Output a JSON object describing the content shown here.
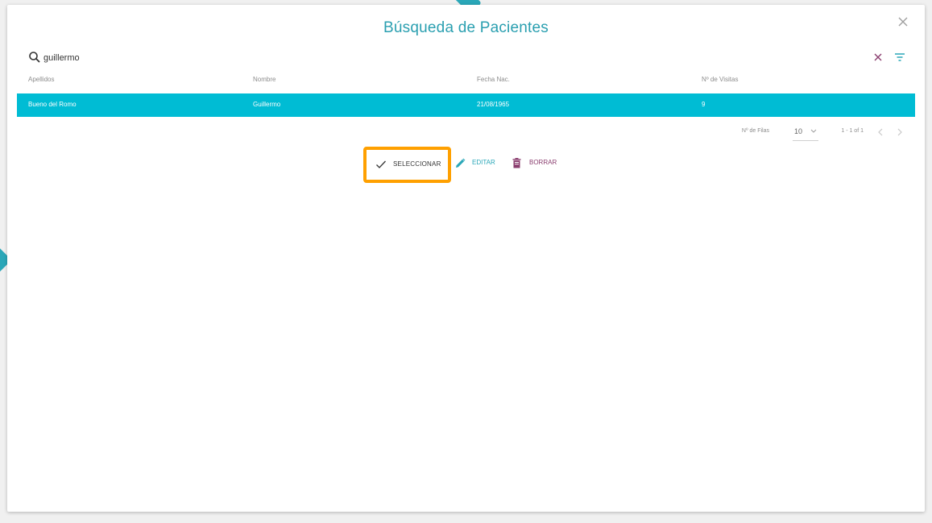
{
  "dialog": {
    "title": "Búsqueda de Pacientes",
    "close_icon": "close-icon"
  },
  "search": {
    "value": "guillermo",
    "placeholder": "",
    "search_icon": "search-icon",
    "clear_icon": "clear-icon",
    "filter_icon": "filter-icon"
  },
  "table": {
    "columns": [
      "Apellidos",
      "Nombre",
      "Fecha Nac.",
      "Nº de Visitas"
    ],
    "rows": [
      [
        "Bueno del Romo",
        "Guillermo",
        "21/08/1965",
        "9"
      ]
    ],
    "selected_row_color": "#00bcd4"
  },
  "paginator": {
    "rows_label": "Nº de Filas",
    "page_size": "10",
    "range": "1 - 1 of 1"
  },
  "actions": {
    "select_label": "SELECCIONAR",
    "edit_label": "EDITAR",
    "delete_label": "BORRAR",
    "highlight_color": "#ffa000",
    "accent_color": "#2aa7b8",
    "delete_color": "#8a3d6e"
  }
}
